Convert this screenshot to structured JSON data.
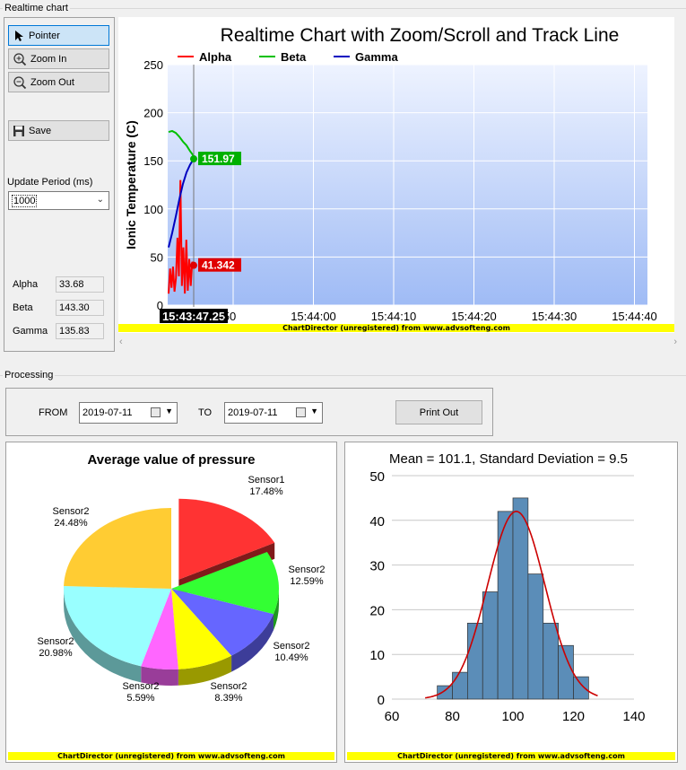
{
  "realtime_group_title": "Realtime chart",
  "toolbar": {
    "pointer_label": "Pointer",
    "zoom_in_label": "Zoom In",
    "zoom_out_label": "Zoom Out",
    "save_label": "Save"
  },
  "update_period": {
    "label": "Update Period (ms)",
    "value": "1000"
  },
  "readouts": [
    {
      "label": "Alpha",
      "value": "33.68"
    },
    {
      "label": "Beta",
      "value": "143.30"
    },
    {
      "label": "Gamma",
      "value": "135.83"
    }
  ],
  "watermark": "ChartDirector (unregistered) from www.advsofteng.com",
  "processing": {
    "group_title": "Processing",
    "from_label": "FROM",
    "from_date": "2019-07-11",
    "to_label": "TO",
    "to_date": "2019-07-11",
    "print_label": "Print Out"
  },
  "chart_data": [
    {
      "type": "line",
      "title": "Realtime Chart with Zoom/Scroll and Track Line",
      "ylabel": "Ionic Temperature (C)",
      "ylim": [
        0,
        250
      ],
      "y_ticks": [
        "0",
        "50",
        "100",
        "150",
        "200",
        "250"
      ],
      "x_ticks": [
        "15:43:50",
        "15:44:00",
        "15:44:10",
        "15:44:20",
        "15:44:30",
        "15:44:40"
      ],
      "x_tick_visible": [
        "50",
        "15:44:00",
        "15:44:10",
        "15:44:20",
        "15:44:30",
        "15:44:40"
      ],
      "track_time": "15:43:47.25",
      "grid": true,
      "legend_position": "top",
      "series": [
        {
          "name": "Alpha",
          "color": "#ff0000",
          "track_value": "41.342",
          "values": [
            12,
            38,
            18,
            40,
            14,
            28,
            70,
            30,
            130,
            20,
            60,
            12,
            68,
            15,
            48,
            20,
            45,
            41
          ]
        },
        {
          "name": "Beta",
          "color": "#00c000",
          "track_value": "",
          "values": [
            180,
            181,
            179,
            175,
            170,
            166,
            160,
            155
          ]
        },
        {
          "name": "Gamma",
          "color": "#0000c0",
          "track_value": "151.97",
          "values": [
            60,
            75,
            92,
            110,
            126,
            138,
            146,
            152
          ]
        }
      ]
    },
    {
      "type": "pie",
      "title": "Average value of pressure",
      "slices": [
        {
          "label": "Sensor1",
          "percent": "17.48%",
          "value": 17.48,
          "color": "#ff3333"
        },
        {
          "label": "Sensor2",
          "percent": "12.59%",
          "value": 12.59,
          "color": "#33ff33"
        },
        {
          "label": "Sensor2",
          "percent": "10.49%",
          "value": 10.49,
          "color": "#6666ff"
        },
        {
          "label": "Sensor2",
          "percent": "8.39%",
          "value": 8.39,
          "color": "#ffff00"
        },
        {
          "label": "Sensor2",
          "percent": "5.59%",
          "value": 5.59,
          "color": "#ff66ff"
        },
        {
          "label": "Sensor2",
          "percent": "20.98%",
          "value": 20.98,
          "color": "#99ffff"
        },
        {
          "label": "Sensor2",
          "percent": "24.48%",
          "value": 24.48,
          "color": "#ffcc33"
        }
      ]
    },
    {
      "type": "bar",
      "title": "Mean = 101.1, Standard Deviation = 9.5",
      "xlim": [
        60,
        140
      ],
      "ylim": [
        0,
        50
      ],
      "x_ticks": [
        "60",
        "80",
        "100",
        "120",
        "140"
      ],
      "y_ticks": [
        "0",
        "10",
        "20",
        "30",
        "40",
        "50"
      ],
      "bin_width": 5,
      "bin_starts": [
        75,
        80,
        85,
        90,
        95,
        100,
        105,
        110,
        115,
        120
      ],
      "values": [
        3,
        6,
        17,
        24,
        42,
        45,
        28,
        17,
        12,
        5
      ],
      "bar_color": "#5b8db8",
      "curve_color": "#cc0000",
      "mean": 101.1,
      "sd": 9.5,
      "curve_peak": 42
    }
  ]
}
